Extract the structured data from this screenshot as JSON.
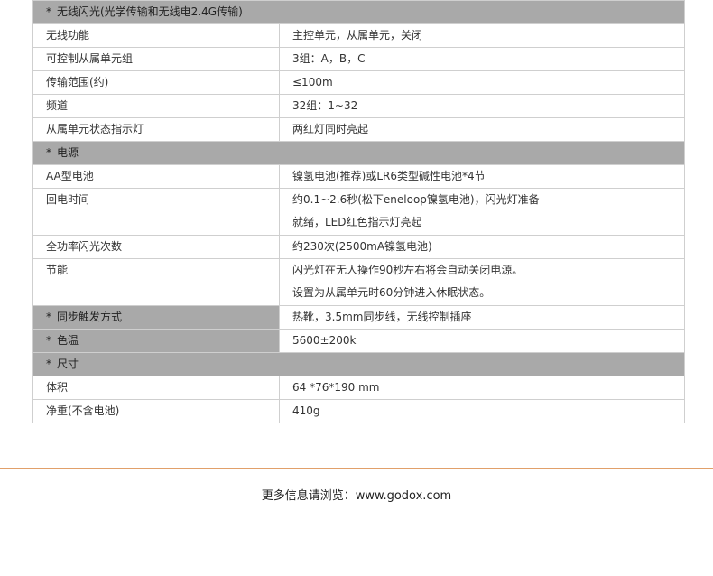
{
  "sections": {
    "wireless_flash": "无线闪光(光学传输和无线电2.4G传输)",
    "power": "电源",
    "sync_mode": "同步触发方式",
    "sync_mode_value": "热靴，3.5mm同步线，无线控制插座",
    "color_temp": "色温",
    "color_temp_value": "5600±200k",
    "dimensions": "尺寸"
  },
  "wireless_rows": [
    {
      "label": "无线功能",
      "value": "主控单元，从属单元，关闭"
    },
    {
      "label": "可控制从属单元组",
      "value": "3组：A，B，C"
    },
    {
      "label": "传输范围(约)",
      "value": "≤100m"
    },
    {
      "label": "频道",
      "value": "32组：1~32"
    },
    {
      "label": "从属单元状态指示灯",
      "value": "两红灯同时亮起"
    }
  ],
  "power_rows": {
    "battery": {
      "label": "AA型电池",
      "value": "镍氢电池(推荐)或LR6类型碱性电池*4节"
    },
    "recycle": {
      "label": "回电时间",
      "line1": "约0.1~2.6秒(松下eneloop镍氢电池)，闪光灯准备",
      "line2": "就绪，LED红色指示灯亮起"
    },
    "flashes": {
      "label": "全功率闪光次数",
      "value": "约230次(2500mA镍氢电池)"
    },
    "saving": {
      "label": "节能",
      "line1": "闪光灯在无人操作90秒左右将会自动关闭电源。",
      "line2": "设置为从属单元时60分钟进入休眠状态。"
    }
  },
  "dimension_rows": [
    {
      "label": "体积",
      "value": "64 *76*190 mm"
    },
    {
      "label": "净重(不含电池)",
      "value": "410g"
    }
  ],
  "section_marker": "*",
  "footer": {
    "text": "更多信息请浏览：www.godox.com"
  },
  "colors": {
    "section_bg": "#a9a9a9",
    "border": "#cfcfcf",
    "divider": "#e1a06a"
  }
}
